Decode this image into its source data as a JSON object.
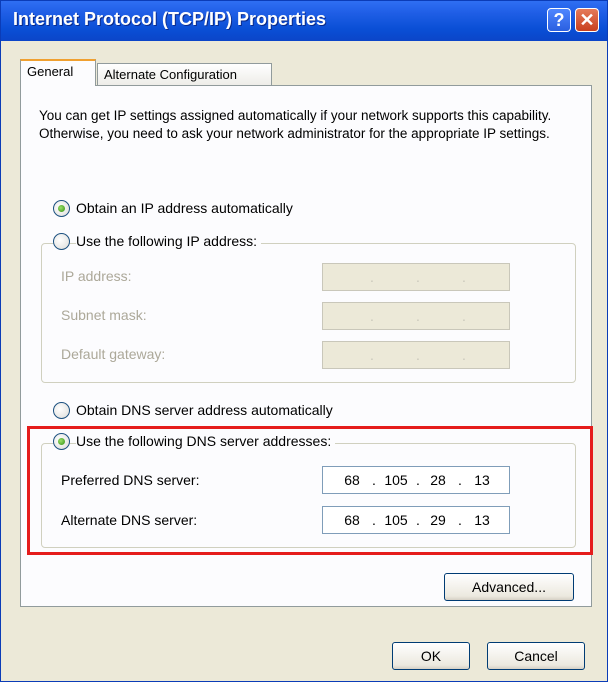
{
  "window": {
    "title": "Internet Protocol (TCP/IP) Properties",
    "help_button": "?",
    "close_button": "✕"
  },
  "tabs": [
    {
      "label": "General",
      "active": true
    },
    {
      "label": "Alternate Configuration",
      "active": false
    }
  ],
  "description": "You can get IP settings assigned automatically if your network supports this capability. Otherwise, you need to ask your network administrator for the appropriate IP settings.",
  "ip": {
    "auto_label": "Obtain an IP address automatically",
    "auto_selected": true,
    "manual_label": "Use the following IP address:",
    "manual_selected": false,
    "fields": [
      {
        "label": "IP address:",
        "octets": [
          "",
          "",
          "",
          ""
        ]
      },
      {
        "label": "Subnet mask:",
        "octets": [
          "",
          "",
          "",
          ""
        ]
      },
      {
        "label": "Default gateway:",
        "octets": [
          "",
          "",
          "",
          ""
        ]
      }
    ]
  },
  "dns": {
    "auto_label": "Obtain DNS server address automatically",
    "auto_selected": false,
    "manual_label": "Use the following DNS server addresses:",
    "manual_selected": true,
    "preferred": {
      "label": "Preferred DNS server:",
      "octets": [
        "68",
        "105",
        "28",
        "13"
      ]
    },
    "alternate": {
      "label": "Alternate DNS server:",
      "octets": [
        "68",
        "105",
        "29",
        "13"
      ]
    }
  },
  "buttons": {
    "advanced": "Advanced...",
    "ok": "OK",
    "cancel": "Cancel"
  },
  "colors": {
    "highlight": "#e51c1c",
    "titlebar": "#0a4fd6"
  }
}
